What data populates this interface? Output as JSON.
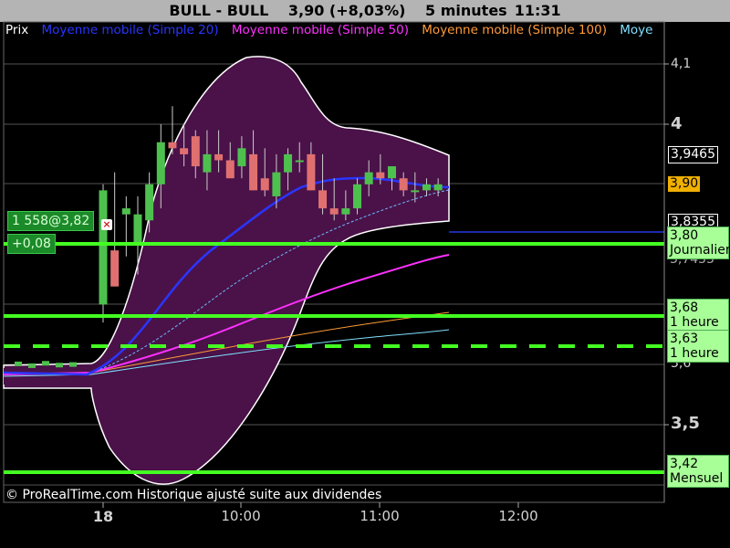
{
  "header": {
    "instrument": "BULL - BULL",
    "price_change": "3,90 (+8,03%)",
    "timeframe": "5 minutes",
    "time": "11:31"
  },
  "legend": [
    {
      "label": "Prix",
      "color": "#ffffff"
    },
    {
      "label": "Moyenne mobile (Simple 20)",
      "color": "#2a35ff"
    },
    {
      "label": "Moyenne mobile (Simple 50)",
      "color": "#ff30ff"
    },
    {
      "label": "Moyenne mobile (Simple 100)",
      "color": "#ff9a3a"
    },
    {
      "label": "Moye",
      "color": "#7fe0ff"
    }
  ],
  "y_axis": {
    "ticks": [
      "4,1",
      "4",
      "3,5"
    ],
    "partial_tick": "3,6",
    "bands": {
      "upper": "3,9465",
      "lower": "3,8355"
    },
    "current_price": "3,90",
    "hidden_tick": "3,7455"
  },
  "x_axis": {
    "ticks": [
      "18",
      "10:00",
      "11:00",
      "12:00"
    ]
  },
  "support_levels": [
    {
      "price": "3,80",
      "period": "Journalier"
    },
    {
      "price": "3,68",
      "period": "1 heure"
    },
    {
      "price": "3,63",
      "period": "1 heure"
    },
    {
      "price": "3,42",
      "period": "Mensuel"
    }
  ],
  "order": {
    "position": "1 558@3,82",
    "pnl": "+0,08"
  },
  "close_glyph": "×",
  "copyright": "© ProRealTime.com Historique ajusté suite aux dividendes",
  "colors": {
    "bollinger_fill": "#4a1248",
    "support_line": "#44ff22",
    "mm20": "#2a35ff",
    "mm50": "#ff30ff",
    "mm100": "#ff9a3a",
    "mm200": "#7fe0ff",
    "candle_up": "#4ec04e",
    "candle_down": "#e07070",
    "price_box": "#f0b000"
  },
  "chart_data": {
    "type": "candlestick",
    "x": [
      "09:05",
      "09:10",
      "09:15",
      "09:20",
      "09:25",
      "09:30",
      "09:35",
      "09:40",
      "09:45",
      "09:50",
      "09:55",
      "10:00",
      "10:05",
      "10:10",
      "10:15",
      "10:20",
      "10:25",
      "10:30",
      "10:35",
      "10:40",
      "10:45",
      "10:50",
      "10:55",
      "11:00",
      "11:05",
      "11:10",
      "11:15",
      "11:20",
      "11:25",
      "11:30"
    ],
    "open": [
      3.7,
      3.79,
      3.85,
      3.8,
      3.84,
      3.9,
      3.97,
      3.96,
      3.98,
      3.92,
      3.95,
      3.94,
      3.93,
      3.95,
      3.91,
      3.88,
      3.92,
      3.94,
      3.95,
      3.89,
      3.86,
      3.85,
      3.86,
      3.9,
      3.92,
      3.91,
      3.91,
      3.89,
      3.89,
      3.89
    ],
    "high": [
      3.9,
      3.92,
      3.88,
      3.88,
      3.92,
      4.0,
      4.03,
      4.0,
      3.99,
      3.99,
      3.99,
      3.97,
      3.98,
      3.99,
      3.96,
      3.95,
      3.96,
      3.97,
      3.97,
      3.95,
      3.91,
      3.89,
      3.91,
      3.94,
      3.95,
      3.93,
      3.92,
      3.92,
      3.91,
      3.91
    ],
    "low": [
      3.67,
      3.73,
      3.78,
      3.75,
      3.82,
      3.86,
      3.95,
      3.93,
      3.91,
      3.89,
      3.92,
      3.92,
      3.91,
      3.89,
      3.88,
      3.86,
      3.89,
      3.92,
      3.89,
      3.85,
      3.84,
      3.84,
      3.85,
      3.88,
      3.9,
      3.89,
      3.88,
      3.87,
      3.88,
      3.88
    ],
    "close": [
      3.89,
      3.73,
      3.86,
      3.85,
      3.9,
      3.97,
      3.96,
      3.95,
      3.93,
      3.95,
      3.94,
      3.91,
      3.96,
      3.89,
      3.89,
      3.92,
      3.95,
      3.94,
      3.89,
      3.86,
      3.85,
      3.86,
      3.9,
      3.92,
      3.91,
      3.93,
      3.89,
      3.89,
      3.9,
      3.9
    ]
  }
}
